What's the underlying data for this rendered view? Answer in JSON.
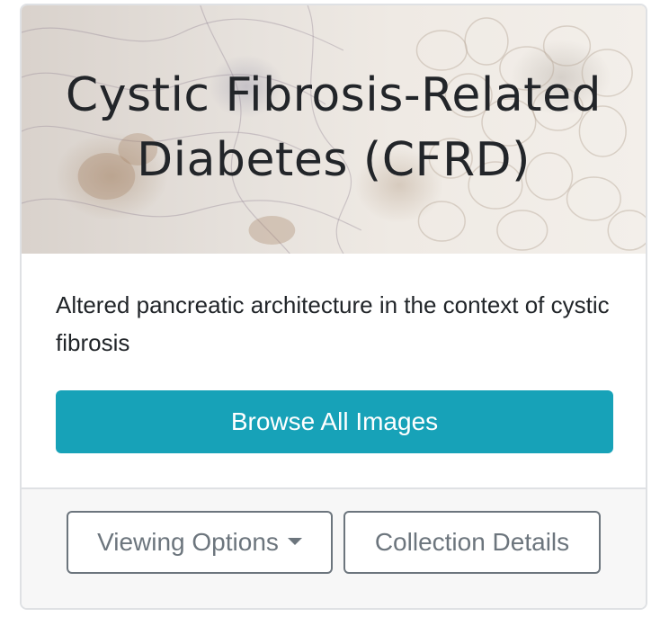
{
  "card": {
    "title": "Cystic Fibrosis-Related Diabetes (CFRD)",
    "description": "Altered pancreatic architecture in the context of cystic fibrosis",
    "browse_button": "Browse All Images"
  },
  "footer": {
    "viewing_options_label": "Viewing Options",
    "collection_details_label": "Collection Details"
  },
  "colors": {
    "primary_button": "#17a2b8",
    "outline_button": "#6c757d",
    "footer_bg": "#f7f7f7"
  },
  "icons": {
    "dropdown": "caret-down-icon"
  }
}
